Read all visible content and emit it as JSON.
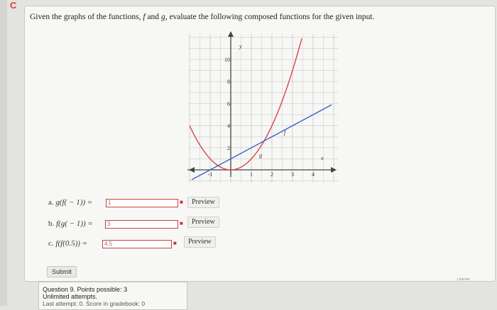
{
  "browser": {
    "reload_glyph": "C"
  },
  "question": {
    "prompt_prefix": "Given the graphs of the functions,",
    "f": "f",
    "and": "and",
    "g": "g",
    "prompt_suffix": ", evaluate the following composed functions for the given input."
  },
  "graph": {
    "axis_label_y": "y",
    "axis_label_x": "x",
    "curve_label_f": "f",
    "curve_label_g": "g",
    "y_ticks": [
      "10",
      "8",
      "6",
      "4",
      "2"
    ],
    "x_ticks": [
      "-1",
      "1",
      "2",
      "3",
      "4"
    ],
    "colors": {
      "f": "#3b5fd1",
      "g": "#d7464a",
      "grid": "#c8c8c8"
    }
  },
  "parts": [
    {
      "label": "a.",
      "expr": "g(f( − 1)) =",
      "value": "1",
      "preview": "Preview"
    },
    {
      "label": "b.",
      "expr": "f(g( − 1)) =",
      "value": "3",
      "preview": "Preview"
    },
    {
      "label": "c.",
      "expr": "f(f(0.5)) =",
      "value": "4.5",
      "preview": "Preview"
    }
  ],
  "submit_label": "Submit",
  "license_label": "License",
  "info": {
    "question_number": "Question 9. Points possible: 3",
    "attempts": "Unlimited attempts.",
    "last": "Last attempt: 0. Score in gradebook: 0"
  }
}
